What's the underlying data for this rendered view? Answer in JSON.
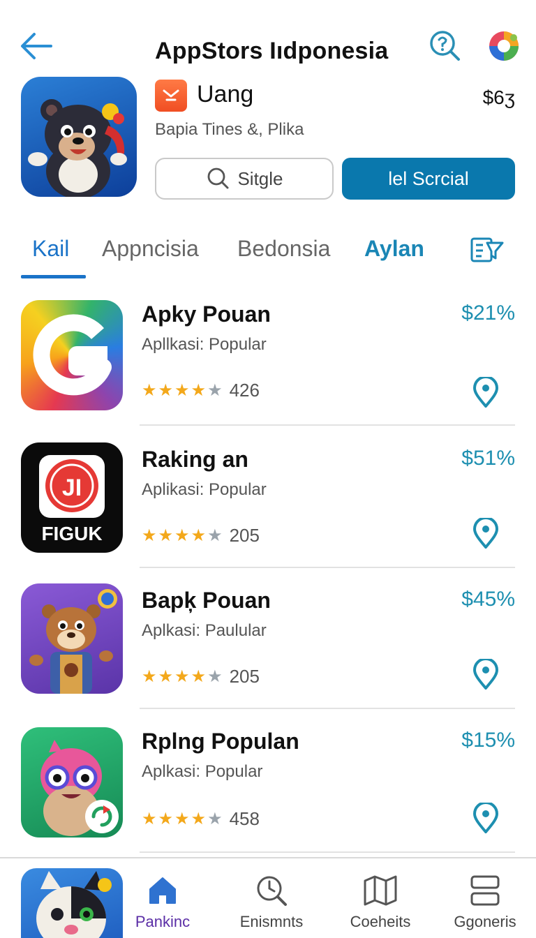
{
  "header": {
    "title": "AppStors Iıdponesia",
    "back_icon": "arrow-left-icon",
    "search_icon": "search-info-icon",
    "avatar_icon": "colorful-logo-icon"
  },
  "featured": {
    "name": "Uang",
    "price": "$6ʒ",
    "subtitle": "Bapia Tines &, Plika",
    "secondary_button": "Sitgle",
    "primary_button": "lel Scrcial"
  },
  "tabs": [
    {
      "label": "Kail",
      "active": true
    },
    {
      "label": "Appncisia",
      "active": false
    },
    {
      "label": "Bedonsia",
      "active": false
    },
    {
      "label": "Aylan",
      "active": false
    }
  ],
  "apps": [
    {
      "name": "Apky Pouan",
      "category": "Apllkasi: Popular",
      "rating": 4,
      "count": "426",
      "price": "$21%"
    },
    {
      "name": "Raking an",
      "category": "Aplikasi: Popular",
      "rating": 4,
      "count": "205",
      "price": "$51%",
      "icon_text": "FIGUK",
      "icon_glyph": "JI"
    },
    {
      "name": "Bapķ Pouan",
      "category": "Aplkasi: Paulular",
      "rating": 4,
      "count": "205",
      "price": "$45%"
    },
    {
      "name": "Rplng Populan",
      "category": "Aplkasi: Popular",
      "rating": 4,
      "count": "458",
      "price": "$15%"
    }
  ],
  "bottom_nav": [
    {
      "label": "Pankinc",
      "icon": "home-icon",
      "active": true
    },
    {
      "label": "Enismnts",
      "icon": "clock-search-icon",
      "active": false
    },
    {
      "label": "Coeheits",
      "icon": "map-icon",
      "active": false
    },
    {
      "label": "Ggoneris",
      "icon": "list-icon",
      "active": false
    }
  ],
  "colors": {
    "accent": "#1a73c8",
    "primary_button": "#0a78ad",
    "price": "#1d8fb0",
    "star": "#f3a81b",
    "nav_active": "#5b2ea6"
  }
}
